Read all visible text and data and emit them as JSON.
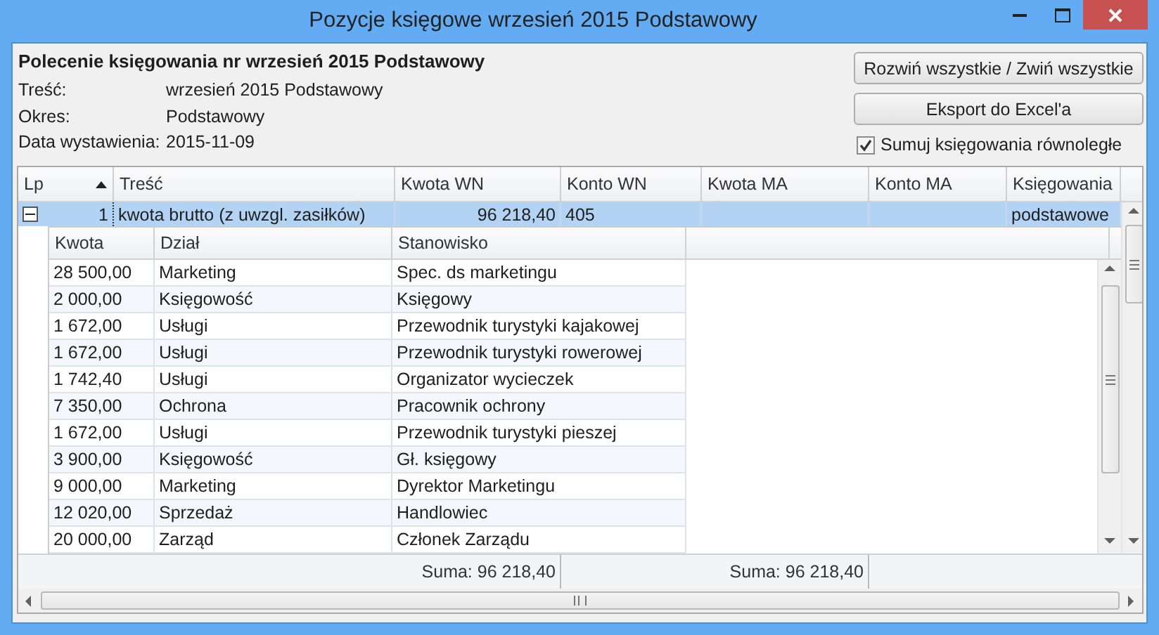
{
  "window": {
    "title": "Pozycje księgowe wrzesień 2015 Podstawowy"
  },
  "header": {
    "heading": "Polecenie księgowania nr  wrzesień 2015 Podstawowy",
    "fields": [
      {
        "label": "Treść:",
        "value": "wrzesień 2015 Podstawowy"
      },
      {
        "label": "Okres:",
        "value": "Podstawowy"
      },
      {
        "label": "Data wystawienia:",
        "value": "2015-11-09"
      }
    ],
    "buttons": [
      "Rozwiń wszystkie / Zwiń wszystkie",
      "Eksport do Excel'a"
    ],
    "checkbox": {
      "label": "Sumuj księgowania równoległe",
      "checked": true
    }
  },
  "grid": {
    "columns": [
      {
        "label": "Lp",
        "sorted": true
      },
      {
        "label": "Treść",
        "sorted": false
      },
      {
        "label": "Kwota WN",
        "sorted": false
      },
      {
        "label": "Konto WN",
        "sorted": false
      },
      {
        "label": "Kwota MA",
        "sorted": false
      },
      {
        "label": "Konto MA",
        "sorted": false
      },
      {
        "label": "Księgowania",
        "sorted": false
      }
    ],
    "rows": [
      {
        "selected": true,
        "expanded": true,
        "cells": [
          "1",
          "kwota brutto (z uwzgl. zasiłków)",
          "96 218,40",
          "405",
          "",
          "",
          "podstawowe"
        ]
      }
    ],
    "detail": {
      "columns": [
        "Kwota",
        "Dział",
        "Stanowisko"
      ],
      "rows": [
        [
          "28 500,00",
          "Marketing",
          "Spec. ds marketingu"
        ],
        [
          "2 000,00",
          "Księgowość",
          "Księgowy"
        ],
        [
          "1 672,00",
          "Usługi",
          "Przewodnik turystyki kajakowej"
        ],
        [
          "1 672,00",
          "Usługi",
          "Przewodnik turystyki rowerowej"
        ],
        [
          "1 742,40",
          "Usługi",
          "Organizator wycieczek"
        ],
        [
          "7 350,00",
          "Ochrona",
          "Pracownik ochrony"
        ],
        [
          "1 672,00",
          "Usługi",
          "Przewodnik turystyki pieszej"
        ],
        [
          "3 900,00",
          "Księgowość",
          "Gł. księgowy"
        ],
        [
          "9 000,00",
          "Marketing",
          "Dyrektor Marketingu"
        ],
        [
          "12 020,00",
          "Sprzedaż",
          "Handlowiec"
        ],
        [
          "20 000,00",
          "Zarząd",
          "Członek Zarządu"
        ]
      ]
    },
    "totals": {
      "kwota_wn": "Suma: 96 218,40",
      "kwota_ma": "Suma: 96 218,40"
    }
  }
}
